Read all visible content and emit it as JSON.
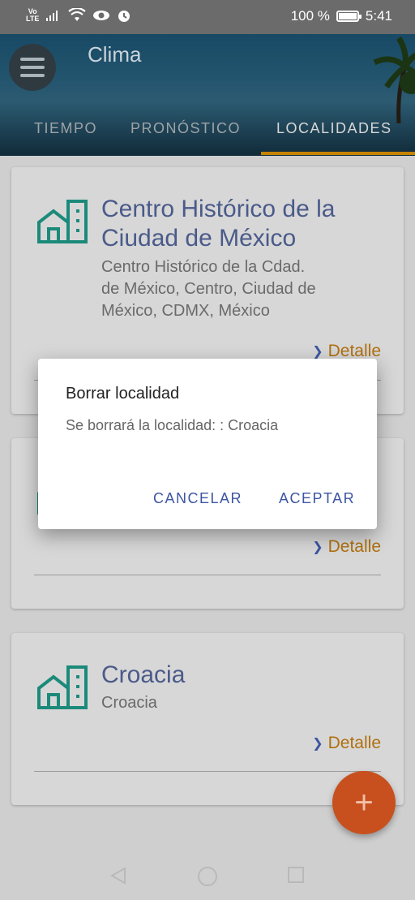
{
  "status_bar": {
    "volte_label": "Vo\nLTE",
    "battery_text": "100 %",
    "battery_level": 1.0,
    "time": "5:41",
    "icons": [
      "volte-icon",
      "signal-icon",
      "wifi-icon",
      "eye-icon",
      "alarm-icon",
      "battery-icon"
    ]
  },
  "app_bar": {
    "title": "Clima",
    "tabs": [
      {
        "label": "TIEMPO",
        "active": false
      },
      {
        "label": "PRONÓSTICO",
        "active": false
      },
      {
        "label": "LOCALIDADES",
        "active": true
      }
    ],
    "indicator_color": "#c58300"
  },
  "locations": [
    {
      "name_line1": "Centro Histórico de la",
      "name_line2": "Ciudad de México",
      "addr_line1": "Centro Histórico de la Cdad.",
      "addr_line2": "de México, Centro, Ciudad de",
      "addr_line3": "México, CDMX, México",
      "detail_label": "Detalle"
    },
    {
      "detail_label": "Detalle"
    },
    {
      "name_line1": "Croacia",
      "addr_line1": "Croacia",
      "detail_label": "Detalle"
    }
  ],
  "dialog": {
    "title": "Borrar localidad",
    "message": "Se borrará la localidad: : Croacia",
    "cancel_label": "CANCELAR",
    "accept_label": "ACEPTAR"
  },
  "fab": {
    "label": "+"
  },
  "colors": {
    "accent": "#3d55a0",
    "detail": "#b0700f",
    "fab": "#c8501f",
    "building_icon": "#1b8a7a"
  }
}
